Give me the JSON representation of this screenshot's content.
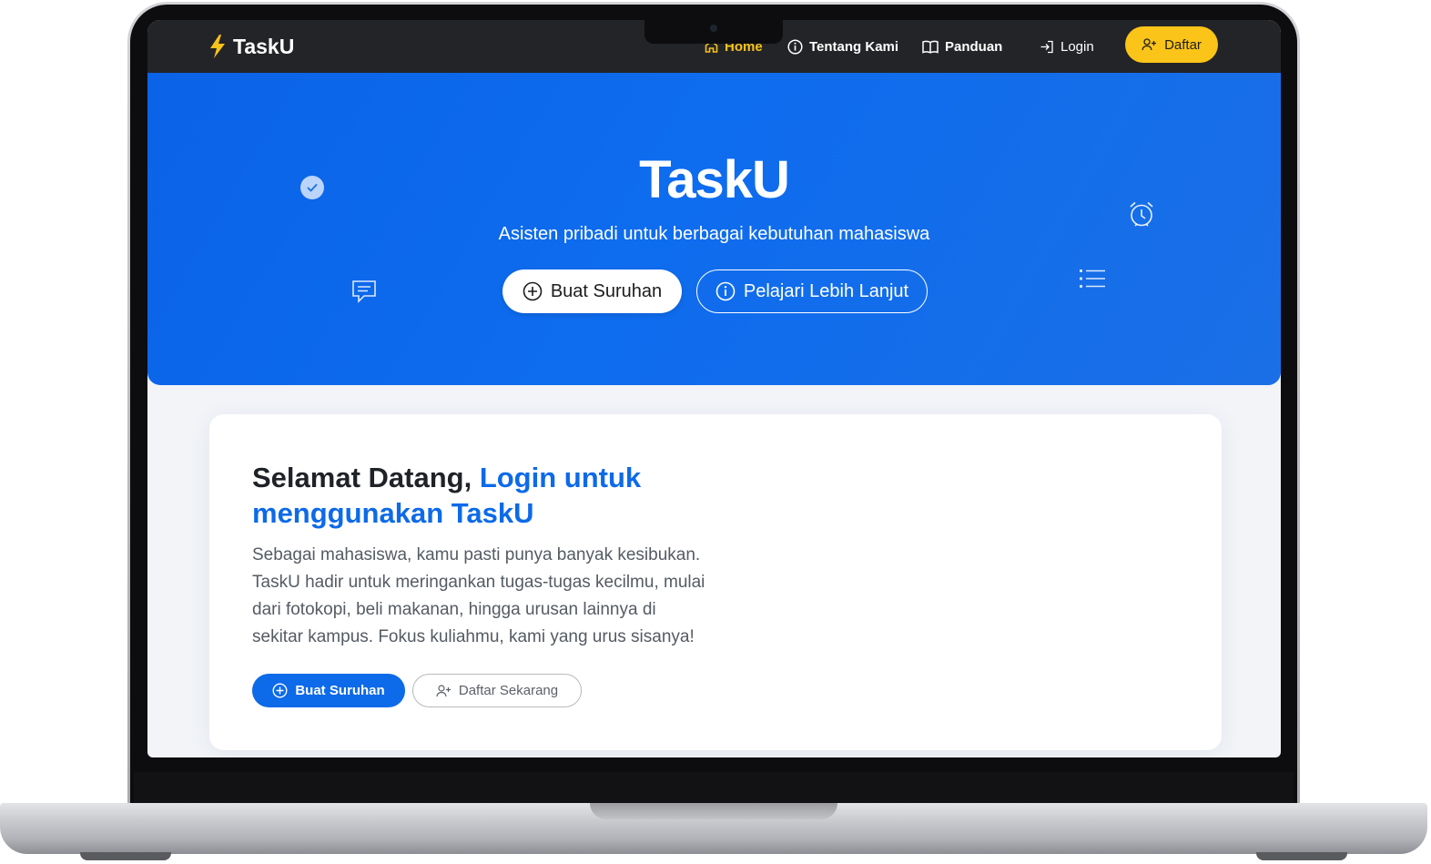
{
  "nav": {
    "brand": "TaskU",
    "items": [
      {
        "label": "Home",
        "icon": "house-icon",
        "active": true
      },
      {
        "label": "Tentang Kami",
        "icon": "info-icon"
      },
      {
        "label": "Panduan",
        "icon": "book-icon"
      },
      {
        "label": "Login",
        "icon": "login-icon"
      }
    ],
    "cta": {
      "label": "Daftar",
      "icon": "user-plus-icon"
    }
  },
  "hero": {
    "title": "TaskU",
    "subtitle": "Asisten pribadi untuk berbagai kebutuhan mahasiswa",
    "primary_button": "Buat Suruhan",
    "secondary_button": "Pelajari Lebih Lanjut",
    "decorations": [
      "check-circle-icon",
      "chat-icon",
      "alarm-clock-icon",
      "list-icon"
    ]
  },
  "card": {
    "title_plain": "Selamat Datang, ",
    "title_highlight": "Login untuk menggunakan TaskU",
    "description": "Sebagai mahasiswa, kamu pasti punya banyak kesibukan. TaskU hadir untuk meringankan tugas-tugas kecilmu, mulai dari fotokopi, beli makanan, hingga urusan lainnya di sekitar kampus. Fokus kuliahmu, kami yang urus sisanya!",
    "primary_button": "Buat Suruhan",
    "secondary_button": "Daftar Sekarang"
  },
  "colors": {
    "navbar": "#232427",
    "accent_yellow": "#fbc418",
    "hero_blue": "#0e6cee",
    "highlight_blue": "#0d6ae8"
  }
}
